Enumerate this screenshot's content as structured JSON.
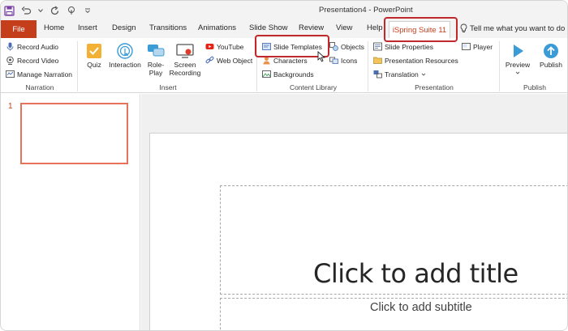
{
  "window": {
    "title": "Presentation4  -  PowerPoint",
    "quick_access": [
      "save-icon",
      "undo-icon",
      "redo-icon",
      "touch-mode-icon",
      "customize-icon"
    ]
  },
  "tabs": {
    "file": "File",
    "items": [
      "Home",
      "Insert",
      "Design",
      "Transitions",
      "Animations",
      "Slide Show",
      "Review",
      "View",
      "Help"
    ],
    "active": "iSpring Suite 11",
    "tell_me": "Tell me what you want to do"
  },
  "ribbon": {
    "narration": {
      "label": "Narration",
      "record_audio": "Record Audio",
      "record_video": "Record Video",
      "manage_narration": "Manage Narration"
    },
    "insert": {
      "label": "Insert",
      "quiz": "Quiz",
      "interaction": "Interaction",
      "role_play": [
        "Role-",
        "Play"
      ],
      "screen_recording": [
        "Screen",
        "Recording"
      ],
      "youtube": "YouTube",
      "web_object": "Web Object"
    },
    "content_library": {
      "label": "Content Library",
      "slide_templates": "Slide Templates",
      "characters": "Characters",
      "backgrounds": "Backgrounds",
      "objects": "Objects",
      "icons": "Icons"
    },
    "presentation": {
      "label": "Presentation",
      "slide_properties": "Slide Properties",
      "presentation_resources": "Presentation Resources",
      "translation": "Translation",
      "player": "Player"
    },
    "publish": {
      "label": "Publish",
      "preview": "Preview",
      "publish": "Publish"
    }
  },
  "slides_panel": {
    "number": "1"
  },
  "slide": {
    "title_placeholder": "Click to add title",
    "subtitle_placeholder": "Click to add subtitle"
  },
  "colors": {
    "accent": "#c43e1c",
    "callout": "#c0282d"
  }
}
